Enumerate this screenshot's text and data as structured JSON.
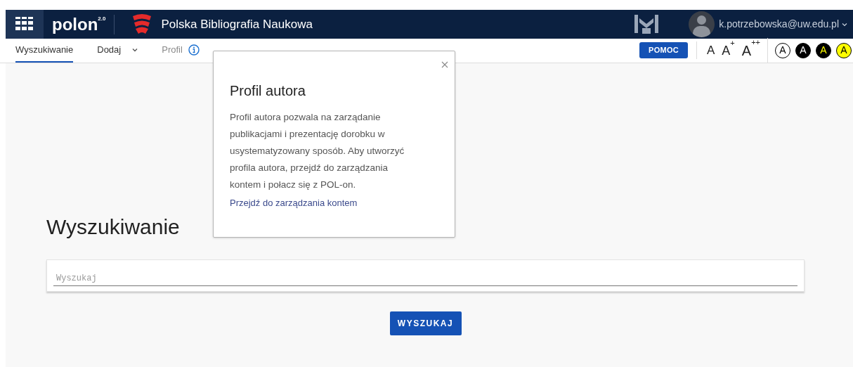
{
  "header": {
    "logo": "polon",
    "logo_version": "2.0",
    "title": "Polska Bibliografia Naukowa",
    "user_email": "k.potrzebowska@uw.edu.pl"
  },
  "nav": {
    "tabs": [
      {
        "label": "Wyszukiwanie",
        "selected": true,
        "disabled": false,
        "kind": "plain"
      },
      {
        "label": "Dodaj",
        "selected": false,
        "disabled": false,
        "kind": "dropdown"
      },
      {
        "label": "Profil",
        "selected": false,
        "disabled": true,
        "kind": "info"
      }
    ],
    "help_button": "POMOC",
    "font_sizes": [
      {
        "label": "A"
      },
      {
        "label": "A",
        "sup": "+"
      },
      {
        "label": "A",
        "sup": "++"
      }
    ],
    "contrast": [
      {
        "label": "A",
        "kind": "default"
      },
      {
        "label": "A",
        "kind": "white-on-black"
      },
      {
        "label": "A",
        "kind": "yellow-on-black"
      },
      {
        "label": "A",
        "kind": "black-on-yellow"
      }
    ]
  },
  "popover": {
    "title": "Profil autora",
    "text": "Profil autora pozwala na zarządanie publikacjami i prezentację dorobku w usystematyzowany sposób. Aby utworzyć profila autora, przejdź do zarządzania kontem i połacz się z POL-on.",
    "link": "Przejdź do zarządzania kontem"
  },
  "main": {
    "heading": "Wyszukiwanie",
    "search": {
      "placeholder": "Wyszukaj"
    },
    "search_button": "WYSZUKAJ"
  }
}
